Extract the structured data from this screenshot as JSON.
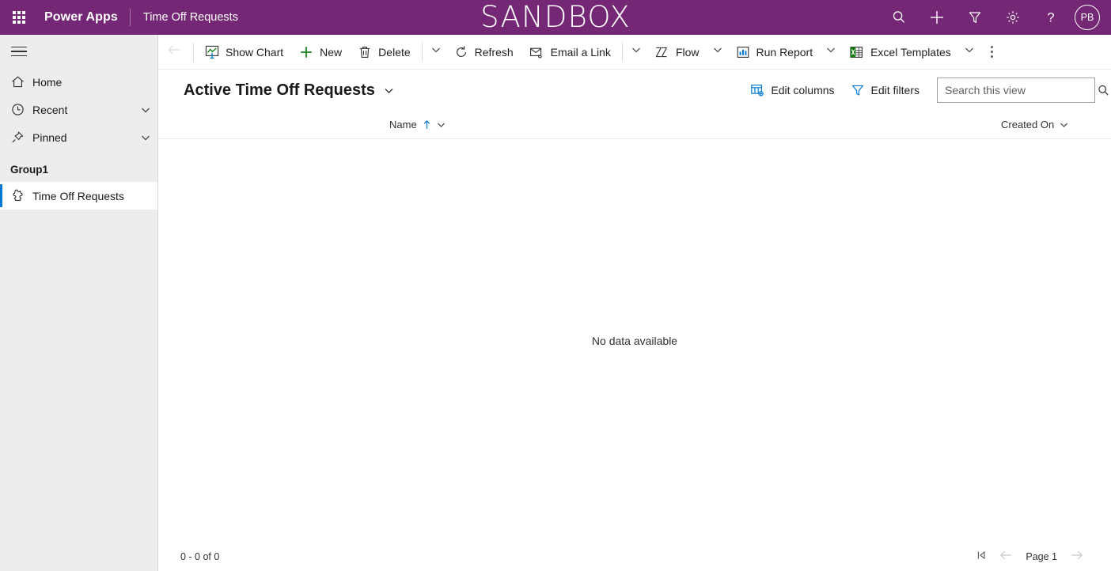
{
  "header": {
    "waffle_label": "app-launcher",
    "brand": "Power Apps",
    "app_name": "Time Off Requests",
    "environment_banner": "SANDBOX",
    "actions": [
      {
        "name": "search-icon",
        "label": "Search"
      },
      {
        "name": "plus-icon",
        "label": "New"
      },
      {
        "name": "filter-icon",
        "label": "Filter"
      },
      {
        "name": "gear-icon",
        "label": "Settings"
      },
      {
        "name": "help-icon",
        "label": "Help"
      }
    ],
    "avatar_initials": "PB",
    "brand_color": "#742774"
  },
  "sidebar": {
    "items": [
      {
        "label": "Home",
        "icon": "home-icon",
        "chevron": false
      },
      {
        "label": "Recent",
        "icon": "clock-icon",
        "chevron": true
      },
      {
        "label": "Pinned",
        "icon": "pin-icon",
        "chevron": true
      }
    ],
    "group_title": "Group1",
    "group_items": [
      {
        "label": "Time Off Requests",
        "icon": "entity-icon",
        "selected": true
      }
    ],
    "accent_color": "#0078d4"
  },
  "commandbar": {
    "back_label": "Back",
    "items": [
      {
        "label": "Show Chart",
        "icon": "show-chart-icon",
        "chevron": false
      },
      {
        "label": "New",
        "icon": "plus-icon",
        "chevron": false
      },
      {
        "label": "Delete",
        "icon": "trash-icon",
        "chevron": true
      },
      {
        "label": "Refresh",
        "icon": "refresh-icon",
        "chevron": false
      },
      {
        "label": "Email a Link",
        "icon": "email-link-icon",
        "chevron": true
      },
      {
        "label": "Flow",
        "icon": "flow-icon",
        "chevron": true
      },
      {
        "label": "Run Report",
        "icon": "run-report-icon",
        "chevron": true
      },
      {
        "label": "Excel Templates",
        "icon": "excel-icon",
        "chevron": true
      }
    ],
    "overflow_label": "More commands"
  },
  "view": {
    "title": "Active Time Off Requests",
    "edit_columns_label": "Edit columns",
    "edit_filters_label": "Edit filters",
    "search_placeholder": "Search this view",
    "search_value": ""
  },
  "grid": {
    "columns": [
      {
        "label": "Name",
        "sorted": "asc"
      },
      {
        "label": "Created On",
        "sorted": "none"
      }
    ],
    "empty_message": "No data available",
    "rows": []
  },
  "footer": {
    "record_count": "0 - 0 of 0",
    "page_label": "Page 1"
  }
}
